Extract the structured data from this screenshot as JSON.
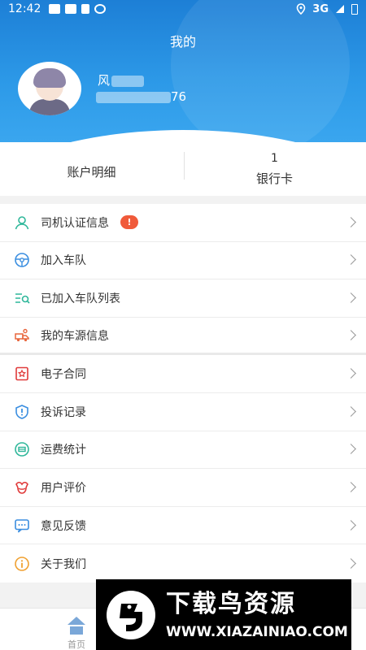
{
  "status_bar": {
    "time": "12:42",
    "network": "3G"
  },
  "header": {
    "title": "我的",
    "user_name_prefix": "风",
    "user_phone_suffix": "76",
    "accent_color": "#2b8fe0"
  },
  "stats": [
    {
      "value": "",
      "label": "账户明细"
    },
    {
      "value": "1",
      "label": "银行卡"
    }
  ],
  "menu": [
    {
      "label": "司机认证信息",
      "icon": "person-icon",
      "badge": "!"
    },
    {
      "label": "加入车队",
      "icon": "steering-wheel-icon"
    },
    {
      "label": "已加入车队列表",
      "icon": "list-search-icon"
    },
    {
      "label": "我的车源信息",
      "icon": "truck-icon"
    },
    {
      "label": "电子合同",
      "icon": "contract-icon"
    },
    {
      "label": "投诉记录",
      "icon": "shield-alert-icon"
    },
    {
      "label": "运费统计",
      "icon": "freight-stats-icon"
    },
    {
      "label": "用户评价",
      "icon": "review-icon"
    },
    {
      "label": "意见反馈",
      "icon": "feedback-icon"
    },
    {
      "label": "关于我们",
      "icon": "info-icon"
    }
  ],
  "tabbar": {
    "home_label": "首页"
  },
  "watermark": {
    "title": "下载鸟资源",
    "url": "WWW.XIAZAINIAO.COM"
  }
}
